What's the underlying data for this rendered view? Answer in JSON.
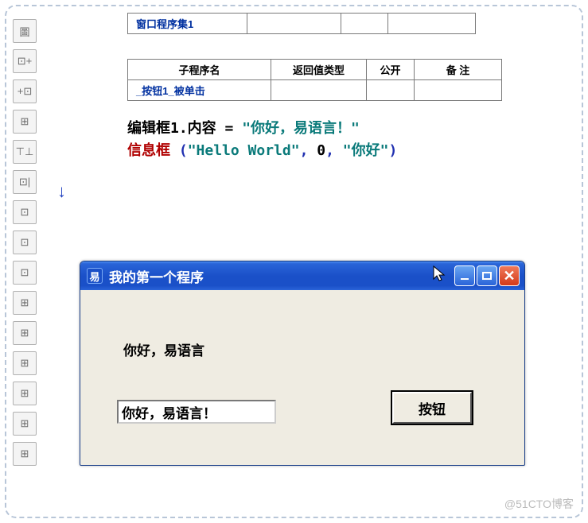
{
  "toolbar": {
    "items": [
      "圖",
      "⊡+",
      "+⊡",
      "⊞",
      "⊤⊥",
      "⊡|",
      "⊡",
      "⊡",
      "⊡",
      "⊞",
      "⊞",
      "⊞",
      "⊞",
      "⊞",
      "⊞"
    ]
  },
  "table1": {
    "cell": "窗口程序集1"
  },
  "table2": {
    "headers": [
      "子程序名",
      "返回值类型",
      "公开",
      "备 注"
    ],
    "row1": "_按钮1_被单击"
  },
  "code": {
    "line1_a": "编辑框1.内容 ",
    "line1_eq": "=",
    "line1_b": " \"你好，易语言！\"",
    "line2_a": "信息框",
    "line2_paren_open": " (",
    "line2_str1": "\"Hello World\"",
    "line2_c1": ", ",
    "line2_num": "0",
    "line2_c2": ", ",
    "line2_str2": "\"你好\"",
    "line2_paren_close": ")"
  },
  "arrow": "↓",
  "window": {
    "icon_text": "易",
    "title": "我的第一个程序",
    "label": "你好，易语言",
    "edit_value": "你好，易语言！",
    "button": "按钮"
  },
  "watermark": "@51CTO博客"
}
